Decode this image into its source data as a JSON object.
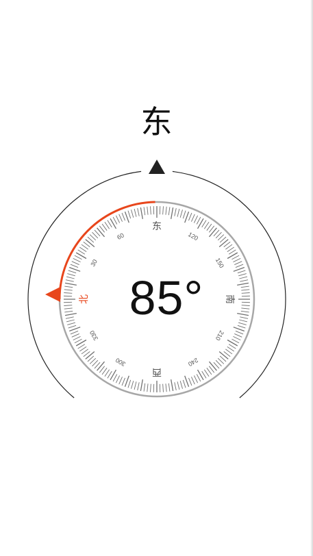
{
  "compass": {
    "direction": "东",
    "heading_value": 85,
    "heading_display": "85°",
    "dial_labels": [
      {
        "angle": 0,
        "text": "东",
        "type": "cardinal"
      },
      {
        "angle": 30,
        "text": "120",
        "type": "number"
      },
      {
        "angle": 60,
        "text": "150",
        "type": "number"
      },
      {
        "angle": 90,
        "text": "南",
        "type": "cardinal"
      },
      {
        "angle": 120,
        "text": "210",
        "type": "number"
      },
      {
        "angle": 150,
        "text": "240",
        "type": "number"
      },
      {
        "angle": 180,
        "text": "西",
        "type": "cardinal"
      },
      {
        "angle": 210,
        "text": "300",
        "type": "number"
      },
      {
        "angle": 240,
        "text": "330",
        "type": "number"
      },
      {
        "angle": 270,
        "text": "北",
        "type": "north"
      },
      {
        "angle": 300,
        "text": "30",
        "type": "number"
      },
      {
        "angle": 330,
        "text": "60",
        "type": "number"
      }
    ],
    "colors": {
      "accent": "#e8461c",
      "tick": "#6e6e6e",
      "ring": "#a7a7a7",
      "outer_arc": "#222222",
      "text": "#111111",
      "label": "#555555"
    },
    "icons": {
      "top_pointer": "triangle-up-icon",
      "north_pointer": "triangle-left-icon"
    }
  }
}
